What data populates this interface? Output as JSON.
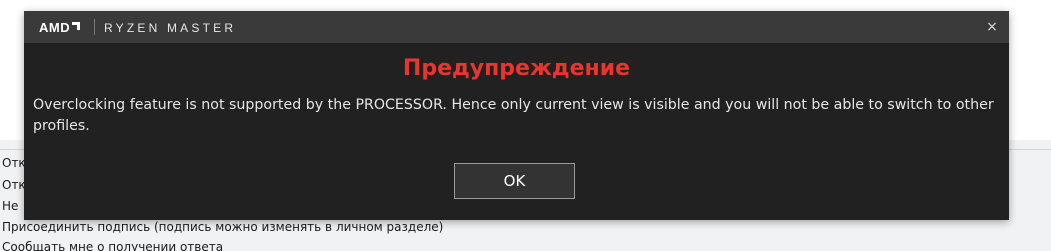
{
  "background": {
    "options": [
      "Отк",
      "Отк",
      "Не",
      "Присоединить подпись (подпись можно изменять в личном разделе)",
      "Сообщать мне о получении ответа"
    ]
  },
  "dialog": {
    "brand": "AMD",
    "app_name": "RYZEN MASTER",
    "close_glyph": "×",
    "heading": "Предупреждение",
    "message": "Overclocking feature is not supported by the PROCESSOR. Hence only current view is visible and you will not be able to switch to other profiles.",
    "ok_label": "OK"
  },
  "colors": {
    "dialog_bg": "#212121",
    "titlebar_bg": "#3a3a3a",
    "heading": "#e8362e",
    "text": "#e6e6e6"
  },
  "icons": {
    "brand_logo": "amd-arrow-icon",
    "close": "close-icon"
  }
}
